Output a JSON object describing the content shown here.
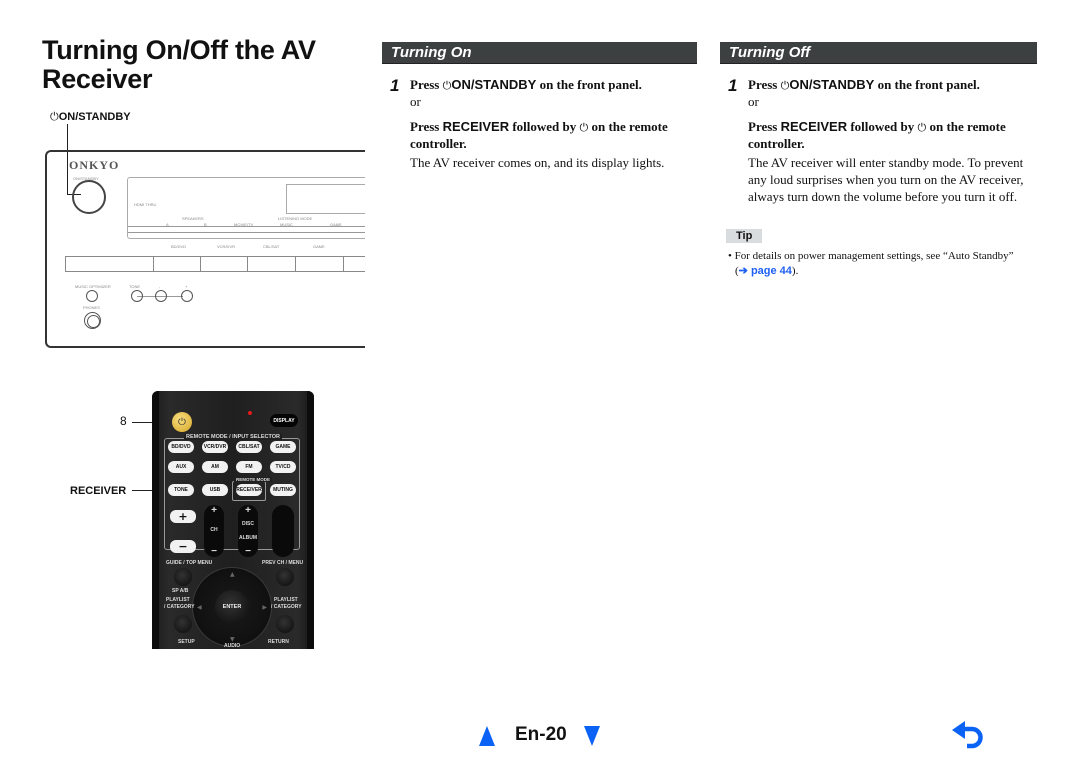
{
  "page": {
    "title": "Turning On/Off the AV Receiver"
  },
  "front_panel": {
    "callout_label": "ON/STANDBY",
    "brand": "ONKYO",
    "power_label": "ON/STANDBY",
    "hdmi_label": "HDMI THRU",
    "speakers_label": "SPEAKERS",
    "speaker_a": "A",
    "speaker_b": "B",
    "listening_mode_label": "LISTENING MODE",
    "modes": [
      "MOVIE/TV",
      "MUSIC",
      "GAME"
    ],
    "inputs": [
      "BD/DVD",
      "VCR/DVR",
      "CBL/SAT",
      "GAME"
    ],
    "music_optimizer": "MUSIC OPTIMIZER",
    "tone": "TONE",
    "minus": "-",
    "plus": "+",
    "phones": "PHONES"
  },
  "remote": {
    "callout_number": "8",
    "callout_receiver": "RECEIVER",
    "power_icon": "⏻",
    "display": "DISPLAY",
    "section_label": "REMOTE MODE / INPUT SELECTOR",
    "remote_mode_label": "REMOTE MODE",
    "row1": [
      "BD/DVD",
      "VCR/DVR",
      "CBL/SAT",
      "GAME"
    ],
    "row2": [
      "AUX",
      "AM",
      "FM",
      "TV/CD"
    ],
    "row3": [
      "TONE",
      "USB",
      "RECEIVER",
      "MUTING"
    ],
    "vol_up": "+",
    "vol_down": "−",
    "ch": {
      "plus": "+",
      "label": "CH",
      "minus": "−"
    },
    "disc": {
      "plus": "+",
      "label_top": "DISC",
      "label_bottom": "ALBUM",
      "minus": "−"
    },
    "guide": "GUIDE / TOP MENU",
    "prev": "PREV CH / MENU",
    "sp": "SP A/B",
    "playlist_left": "PLAYLIST",
    "category_left": "/ CATEGORY",
    "playlist_right": "PLAYLIST",
    "category_right": "/ CATEGORY",
    "enter": "ENTER",
    "setup": "SETUP",
    "audio": "AUDIO",
    "return": "RETURN"
  },
  "sections": {
    "on": {
      "title": "Turning On",
      "step_number": "1",
      "line1_pre": "Press ",
      "line1_icon": "⏻",
      "line1_key": "ON/STANDBY",
      "line1_post": " on the front panel.",
      "or": "or",
      "line2_pre": "Press ",
      "line2_key": "RECEIVER",
      "line2_mid": " followed by ",
      "line2_icon": "⏻",
      "line2_post": " on the remote controller.",
      "description": "The AV receiver comes on, and its display lights."
    },
    "off": {
      "title": "Turning Off",
      "step_number": "1",
      "line1_pre": "Press ",
      "line1_icon": "⏻",
      "line1_key": "ON/STANDBY",
      "line1_post": " on the front panel.",
      "or": "or",
      "line2_pre": "Press ",
      "line2_key": "RECEIVER",
      "line2_mid": " followed by ",
      "line2_icon": "⏻",
      "line2_post": " on the remote controller.",
      "description": "The AV receiver will enter standby mode. To prevent any loud surprises when you turn on the AV receiver, always turn down the volume before you turn it off.",
      "tip": {
        "label": "Tip",
        "bullet": "•",
        "text": "For details on power management settings, see “Auto Standby”",
        "paren_open": "(",
        "link": "➔ page 44",
        "paren_close": ")."
      }
    }
  },
  "footer": {
    "page_number": "En-20",
    "prev_icon": "up-triangle",
    "next_icon": "down-triangle",
    "return_icon": "return-arrow",
    "accent_color": "#0b63f6"
  }
}
